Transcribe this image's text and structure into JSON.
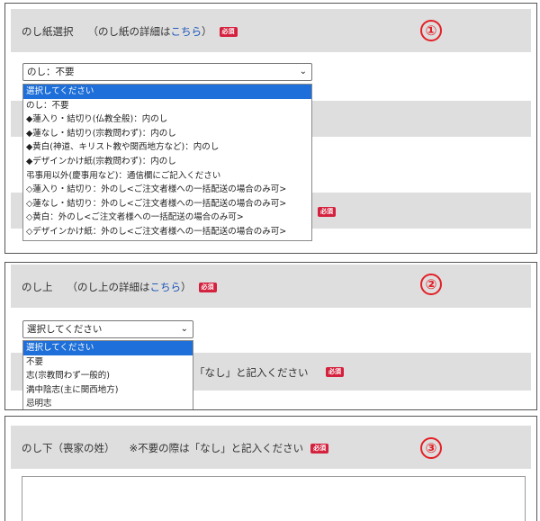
{
  "section1": {
    "number": "①",
    "title": "のし紙選択",
    "detail_prefix": "（のし紙の詳細は",
    "detail_link": "こちら",
    "detail_suffix": "）",
    "badge": "必須",
    "select_value": "のし：不要",
    "options": [
      "選択してください",
      "のし：不要",
      "◆蓮入り・結切り(仏教全般)：内のし",
      "◆蓮なし・結切り(宗教問わず)：内のし",
      "◆黄白(神道、キリスト教や関西地方など)：内のし",
      "◆デザインかけ紙(宗教問わず)：内のし",
      "弔事用以外(慶事用など)：通信欄にご記入ください",
      "◇蓮入り・結切り：外のし<ご注文者様への一括配送の場合のみ可>",
      "◇蓮なし・結切り：外のし<ご注文者様への一括配送の場合のみ可>",
      "◇黄白：外のし<ご注文者様への一括配送の場合のみ可>",
      "◇デザインかけ紙：外のし<ご注文者様への一括配送の場合のみ可>"
    ],
    "selected_index": 0,
    "hidden_badge": "必須"
  },
  "section2": {
    "number": "②",
    "title": "のし上",
    "detail_prefix": "（のし上の詳細は",
    "detail_link": "こちら",
    "detail_suffix": "）",
    "badge": "必須",
    "select_value": "選択してください",
    "options": [
      "選択してください",
      "不要",
      "志(宗教問わず一般的)",
      "満中陰志(主に関西地方)",
      "忌明志"
    ],
    "selected_index": 0,
    "hidden_text": "「なし」と記入ください",
    "hidden_badge": "必須"
  },
  "section3": {
    "number": "③",
    "title": "のし下（喪家の姓）",
    "note": "※不要の際は「なし」と記入ください",
    "badge": "必須"
  }
}
